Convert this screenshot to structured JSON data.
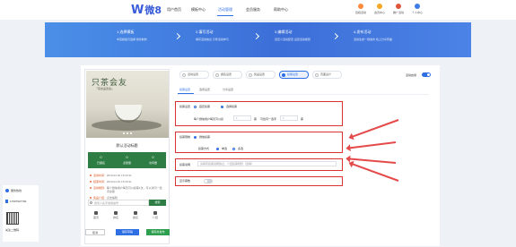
{
  "nav": {
    "logo_mark": "W",
    "logo_text": "微8",
    "items": [
      "用户首页",
      "模板中心",
      "活动管理",
      "会员服务",
      "帮助中心"
    ],
    "tools": [
      "自媒活动",
      "会员中心",
      "推广活动",
      "个人中心"
    ]
  },
  "banner": {
    "steps": [
      {
        "title": "1.选择模板",
        "desc": "丰富模板可选择 简化制作"
      },
      {
        "title": "2.填写活动",
        "desc": "填写活动信息 引导活动参与"
      },
      {
        "title": "3.编辑活动",
        "desc": "自定义活动配置 设置活动规则"
      },
      {
        "title": "4.发布活动",
        "desc": "活动生成一键发布 线上分享传播"
      }
    ]
  },
  "phone": {
    "hero_title": "只茶会友",
    "hero_sub": "『茶友品鉴会』",
    "title": "默认活动标题",
    "stats": [
      {
        "value": "0",
        "label": "已报名"
      },
      {
        "value": "0",
        "label": "点赞量"
      },
      {
        "value": "0",
        "label": "访问量"
      }
    ],
    "lines": [
      {
        "key": "活动时间:",
        "text": "2019-03-30 15:23:31"
      },
      {
        "key": "结束时间:",
        "text": "2019-04-15 15:23:31"
      },
      {
        "key": "活动规则:",
        "text": "每个微信用户每天可以投票1次，可以对同一选手投票"
      },
      {
        "key": "奖品介绍:",
        "text": "点击编辑"
      }
    ],
    "search_placeholder": "搜索人名字或者编号",
    "search_button": "搜索",
    "tabs": [
      "首页",
      "排名",
      "报名",
      "介绍"
    ]
  },
  "buttons": {
    "cancel": "取消",
    "prev": "保存草稿",
    "save": "保存并发布"
  },
  "side": {
    "service": "服务热线",
    "phone": "17607627700",
    "qr_label": "关注二维码"
  },
  "settings": {
    "top_tabs": [
      "活动设置",
      "报名设置",
      "奖品设置",
      "投票设置",
      "页面设计"
    ],
    "active_top_tab": 3,
    "switch_label": "活动启用",
    "sub_tabs": [
      "投票设置",
      "选项设置",
      "分享设置"
    ],
    "vote": {
      "label": "投票设置",
      "opt1": "固定投票",
      "opt2": "选择投票",
      "rule_prefix": "每个微信用户每天可以投",
      "rule_unit": "票",
      "rule_mid": "可给同一选手",
      "rule_unit2": "票"
    },
    "limit": {
      "label": "投票限制",
      "opt_on": "微信投票",
      "sub_label": "投票方式",
      "opt1": "单选",
      "opt2": "多选"
    },
    "reason": {
      "label": "投票说明",
      "placeholder": "请填写投票说明信息，介绍投票规则（选填）"
    },
    "show": {
      "label": "显示票数"
    }
  },
  "colors": {
    "accent": "#2f6fe4",
    "green": "#2e7d45",
    "highlight": "#d83232"
  }
}
